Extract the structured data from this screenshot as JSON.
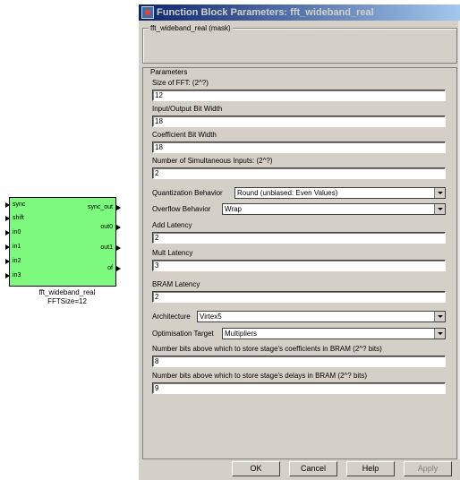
{
  "block": {
    "inputs": [
      "sync",
      "shift",
      "in0",
      "in1",
      "in2",
      "in3"
    ],
    "outputs": [
      "sync_out",
      "out0",
      "out1",
      "of"
    ],
    "name": "fft_wideband_real",
    "annotation": "FFTSize=12"
  },
  "dialog": {
    "title": "Function Block Parameters: fft_wideband_real",
    "mask_group": "fft_wideband_real (mask)",
    "params_legend": "Parameters",
    "params": {
      "fft_size": {
        "label": "Size of FFT: (2^?)",
        "value": "12"
      },
      "io_bit_width": {
        "label": "Input/Output Bit Width",
        "value": "18"
      },
      "coeff_bit_width": {
        "label": "Coefficient Bit Width",
        "value": "18"
      },
      "num_inputs": {
        "label": "Number of Simultaneous Inputs: (2^?)",
        "value": "2"
      },
      "quantization": {
        "label": "Quantization Behavior",
        "value": "Round  (unbiased: Even Values)"
      },
      "overflow": {
        "label": "Overflow Behavior",
        "value": "Wrap"
      },
      "add_latency": {
        "label": "Add Latency",
        "value": "2"
      },
      "mult_latency": {
        "label": "Mult Latency",
        "value": "3"
      },
      "bram_latency": {
        "label": "BRAM Latency",
        "value": "2"
      },
      "architecture": {
        "label": "Architecture",
        "value": "Virtex5"
      },
      "opt_target": {
        "label": "Optimisation Target",
        "value": "Multipliers"
      },
      "coeff_bram": {
        "label": "Number bits above which to store stage's coefficients in BRAM (2^? bits)",
        "value": "8"
      },
      "delay_bram": {
        "label": "Number bits above which to store stage's delays in BRAM (2^? bits)",
        "value": "9"
      }
    },
    "buttons": {
      "ok": "OK",
      "cancel": "Cancel",
      "help": "Help",
      "apply": "Apply"
    }
  }
}
